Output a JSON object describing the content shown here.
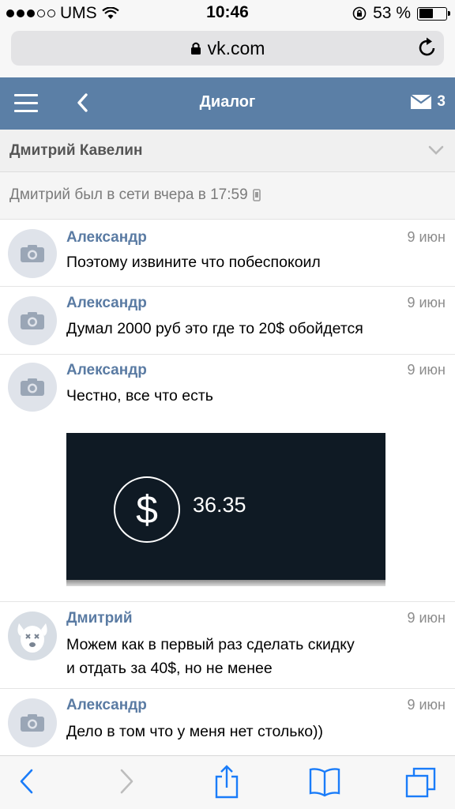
{
  "status_bar": {
    "carrier": "UMS",
    "time": "10:46",
    "battery_percent": "53 %",
    "battery_level": 0.53
  },
  "browser": {
    "url": "vk.com"
  },
  "header": {
    "title": "Диалог",
    "unread_count": "3"
  },
  "dialog": {
    "name": "Дмитрий Кавелин",
    "status": "Дмитрий был в сети вчера в 17:59"
  },
  "messages": [
    {
      "author": "Александр",
      "date": "9 июн",
      "lines": [
        "Поэтому извините что побеспокоил"
      ]
    },
    {
      "author": "Александр",
      "date": "9 июн",
      "lines": [
        "Думал 2000 руб это где то 20$ обойдется"
      ]
    },
    {
      "author": "Александр",
      "date": "9 июн",
      "lines": [
        "Честно, все что есть"
      ],
      "attachment": {
        "symbol": "$",
        "amount": "36.35"
      }
    },
    {
      "author": "Дмитрий",
      "date": "9 июн",
      "lines": [
        "Можем как в первый раз сделать скидку",
        "и отдать за 40$, но не менее"
      ]
    },
    {
      "author": "Александр",
      "date": "9 июн",
      "lines": [
        "Дело в том что у меня нет столько))"
      ]
    }
  ],
  "icons": {
    "menu": "hamburger-icon",
    "back": "chevron-left-icon",
    "mail": "envelope-icon",
    "reload": "reload-icon",
    "lock": "lock-icon",
    "expand": "chevron-down-icon",
    "avatar_default": "camera-icon",
    "avatar_dmitry": "dog-icon",
    "toolbar": [
      "back-icon",
      "forward-icon",
      "share-icon",
      "bookmarks-icon",
      "tabs-icon"
    ]
  },
  "colors": {
    "vk_header": "#5b7fa6",
    "author_name": "#5a7ba3",
    "ios_blue": "#1a7cf9"
  }
}
